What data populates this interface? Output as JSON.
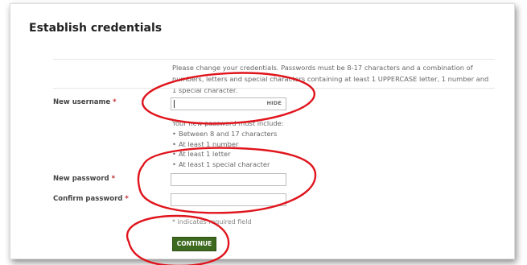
{
  "page": {
    "title": "Establish credentials"
  },
  "intro_text": "Please change your credentials. Passwords must be 8-17 characters and a combination of numbers, letters and special characters containing at least 1 UPPERCASE letter, 1 number and 1 special character.",
  "fields": {
    "username": {
      "label": "New username",
      "required_marker": "*",
      "value": "",
      "toggle_label": "HIDE"
    },
    "password": {
      "label": "New password",
      "required_marker": "*",
      "value": ""
    },
    "confirm_password": {
      "label": "Confirm password",
      "required_marker": "*",
      "value": ""
    }
  },
  "password_rules": {
    "title": "Your new password must include:",
    "items": [
      "Between 8 and 17 characters",
      "At least 1 number",
      "At least 1 letter",
      "At least 1 special character"
    ]
  },
  "required_note": "* indicates required field",
  "continue_label": "CONTINUE",
  "colors": {
    "required": "#c3282e",
    "button": "#3e6a1f",
    "annotation": "#e0141c"
  }
}
